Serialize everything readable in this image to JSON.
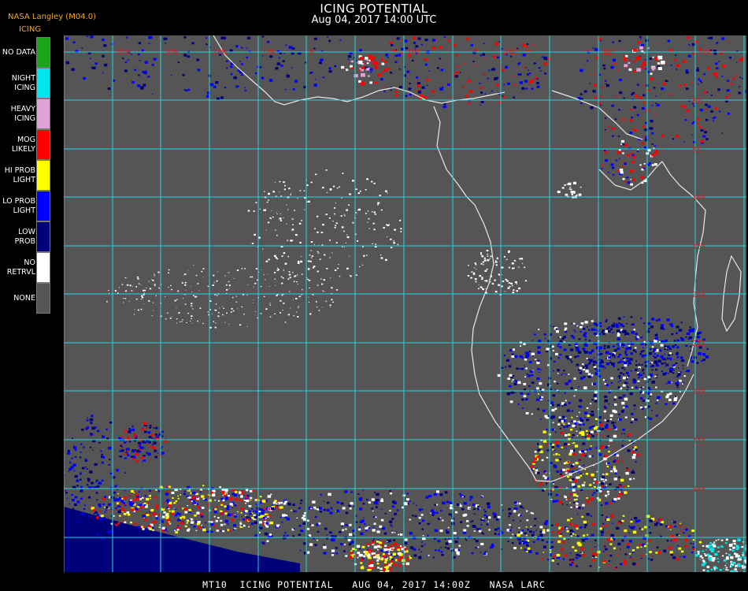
{
  "header": {
    "title": "ICING POTENTIAL",
    "subtitle": "Aug 04, 2017 14:00 UTC",
    "source": "NASA Langley (M04.0)"
  },
  "legend": {
    "title": "ICING",
    "items": [
      {
        "label": "NO DATA",
        "color": "#19a519"
      },
      {
        "label": "NIGHT\nICING",
        "color": "#00e5ee"
      },
      {
        "label": "HEAVY\nICING",
        "color": "#e0a0d8"
      },
      {
        "label": "MOG\nLIKELY",
        "color": "#ff0000"
      },
      {
        "label": "HI PROB\nLIGHT",
        "color": "#ffff00"
      },
      {
        "label": "LO PROB\nLIGHT",
        "color": "#0000ff"
      },
      {
        "label": "LOW\nPROB",
        "color": "#00007a"
      },
      {
        "label": "NO\nRETRVL",
        "color": "#ffffff"
      },
      {
        "label": "NONE",
        "color": "#555555"
      }
    ]
  },
  "map": {
    "background": "#555555",
    "grid_color": "#20d8e0",
    "coast_color": "#e8e8e8",
    "lat_labels": [
      "EQ",
      "5S",
      "10S",
      "15S",
      "20S",
      "25S",
      "30S",
      "35S",
      "40S"
    ],
    "top_labels": [
      "40W",
      "30W",
      "20W",
      "10W",
      "0",
      "10E",
      "20E",
      "30E",
      "40E"
    ]
  },
  "footer": {
    "text": "MT10  ICING POTENTIAL   AUG 04, 2017 14:00Z   NASA LARC"
  }
}
